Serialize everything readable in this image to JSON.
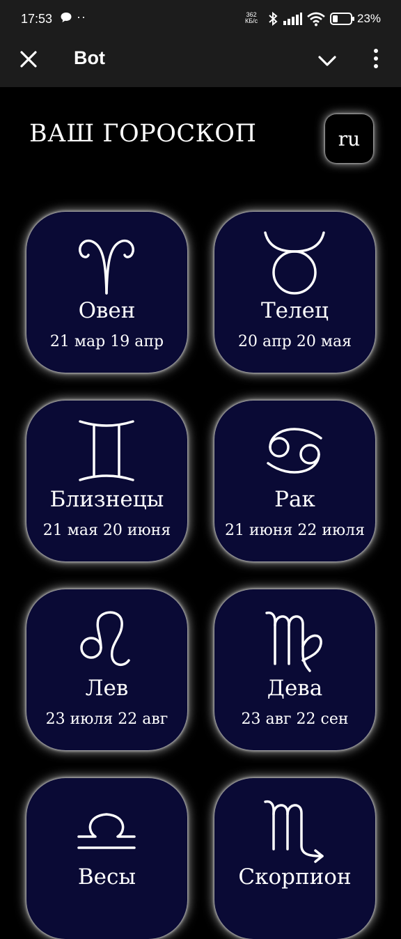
{
  "status_bar": {
    "time": "17:53",
    "dots": "··",
    "rate_value": "362",
    "rate_unit": "КБ/с",
    "battery": "23%"
  },
  "app_bar": {
    "title": "Bot"
  },
  "heading": "ВАШ ГОРОСКОП",
  "language": "ru",
  "signs": [
    {
      "icon": "aries-icon",
      "name": "Овен",
      "dates": "21 мар 19 апр"
    },
    {
      "icon": "taurus-icon",
      "name": "Телец",
      "dates": "20 апр 20 мая"
    },
    {
      "icon": "gemini-icon",
      "name": "Близнецы",
      "dates": "21 мая 20 июня"
    },
    {
      "icon": "cancer-icon",
      "name": "Рак",
      "dates": "21 июня 22 июля"
    },
    {
      "icon": "leo-icon",
      "name": "Лев",
      "dates": "23 июля 22 авг"
    },
    {
      "icon": "virgo-icon",
      "name": "Дева",
      "dates": "23 авг 22 сен"
    },
    {
      "icon": "libra-icon",
      "name": "Весы",
      "dates": ""
    },
    {
      "icon": "scorpio-icon",
      "name": "Скорпион",
      "dates": ""
    }
  ],
  "colors": {
    "card_background": "#0a0a35",
    "bar_background": "#1c1c1c",
    "page_background": "#000000"
  }
}
